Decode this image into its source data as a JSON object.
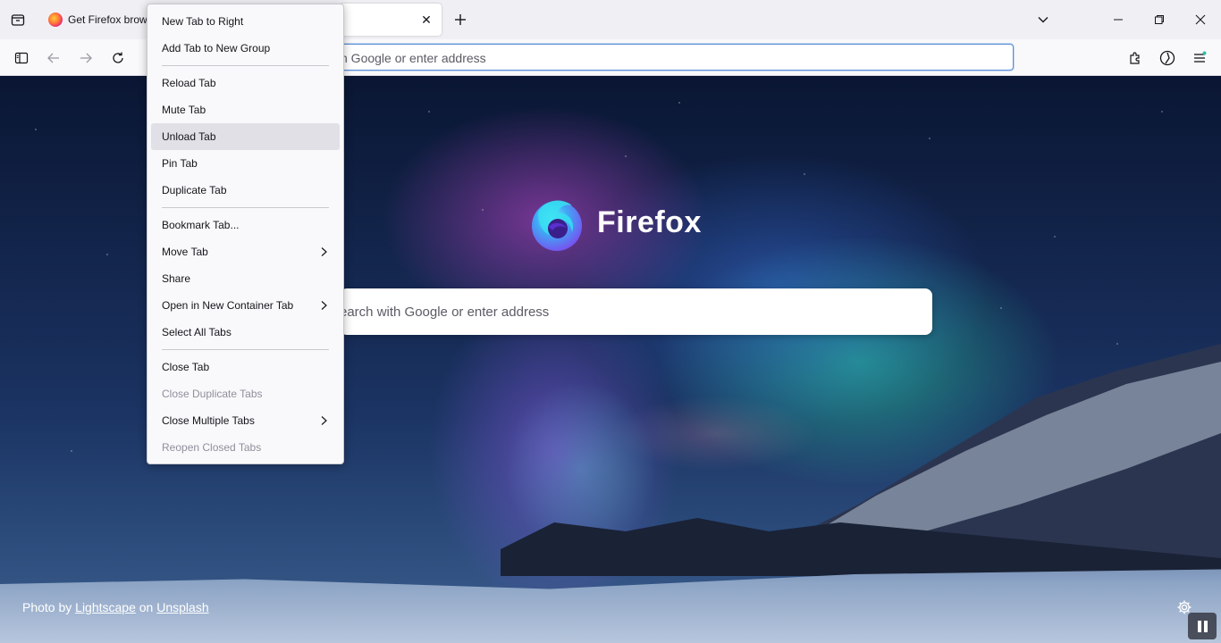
{
  "tabs": {
    "tab1_title": "Get Firefox brow",
    "tab2_title": ""
  },
  "navbar": {
    "url_placeholder": "h Google or enter address"
  },
  "content": {
    "wordmark": "Firefox",
    "search_placeholder": "earch with Google or enter address",
    "credit_prefix": "Photo by",
    "credit_author": "Lightscape",
    "credit_on": "on",
    "credit_source": "Unsplash"
  },
  "context_menu": {
    "items": [
      {
        "label": "New Tab to Right"
      },
      {
        "label": "Add Tab to New Group"
      },
      {
        "label": "Reload Tab"
      },
      {
        "label": "Mute Tab"
      },
      {
        "label": "Unload Tab"
      },
      {
        "label": "Pin Tab"
      },
      {
        "label": "Duplicate Tab"
      },
      {
        "label": "Bookmark Tab..."
      },
      {
        "label": "Move Tab"
      },
      {
        "label": "Share"
      },
      {
        "label": "Open in New Container Tab"
      },
      {
        "label": "Select All Tabs"
      },
      {
        "label": "Close Tab"
      },
      {
        "label": "Close Duplicate Tabs"
      },
      {
        "label": "Close Multiple Tabs"
      },
      {
        "label": "Reopen Closed Tabs"
      }
    ]
  },
  "colors": {
    "accent": "#5b8fd6",
    "menu_hover": "#e0e0e6",
    "disabled_text": "#8f8f9d"
  },
  "icons": [
    "tabs-list-icon",
    "firefox-favicon",
    "close-icon",
    "plus-icon",
    "chevron-down-icon",
    "minimize-icon",
    "maximize-icon",
    "window-close-icon",
    "sidebar-icon",
    "back-icon",
    "forward-icon",
    "reload-icon",
    "extensions-icon",
    "account-icon",
    "menu-icon",
    "firefox-logo",
    "gear-icon",
    "pause-icon",
    "chevron-right-icon"
  ]
}
